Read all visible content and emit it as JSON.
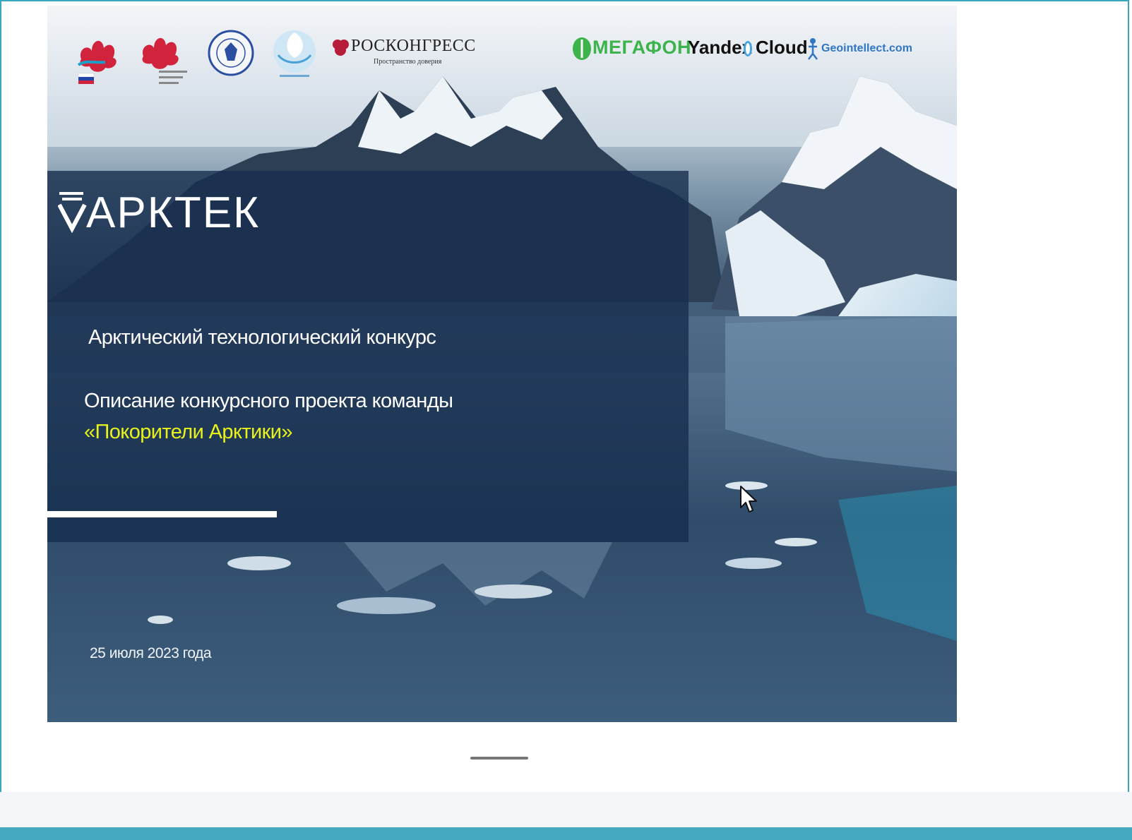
{
  "slide": {
    "brand": "АРКТЕК",
    "subtitle": "Арктический технологический конкурс",
    "description": "Описание конкурсного проекта команды",
    "team_name": "«Покорители Арктики»",
    "date": "25 июля 2023 года"
  },
  "logos": {
    "roscongress": "РОСКОНГРЕСС",
    "roscongress_tagline": "Пространство доверия",
    "megafon": "МЕГАФОН",
    "yandex": "Yandex",
    "cloud": "Cloud",
    "geointellect": "Geointellect.com"
  },
  "colors": {
    "panel": "#182e4e",
    "team_highlight": "#e8f21a",
    "frame_accent": "#3aa7c0",
    "megafon_green": "#3cb44b"
  },
  "icons": [
    "ministry-logo-icon",
    "development-corp-logo-icon",
    "emblem-logo-icon",
    "arctic-council-logo-icon",
    "roscongress-logo-icon",
    "megafon-logo-icon",
    "yandex-cloud-logo-icon",
    "geointellect-logo-icon",
    "mouse-cursor-icon"
  ]
}
